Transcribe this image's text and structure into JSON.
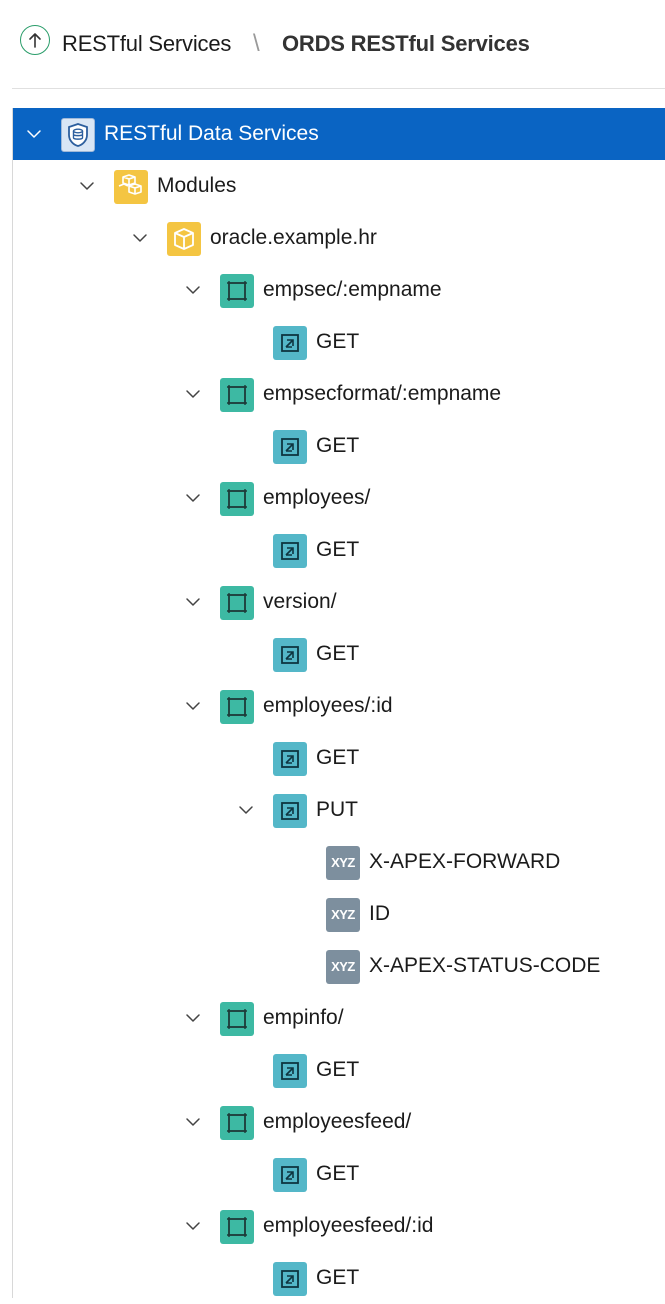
{
  "breadcrumb": {
    "parent": "RESTful Services",
    "separator": "\\",
    "current": "ORDS RESTful Services"
  },
  "tree": [
    {
      "label": "RESTful Data Services",
      "icon": "database-icon",
      "level": 0,
      "expanded": true,
      "selected": true
    },
    {
      "label": "Modules",
      "icon": "modules-icon",
      "level": 1,
      "expanded": true
    },
    {
      "label": "oracle.example.hr",
      "icon": "module-icon",
      "level": 2,
      "expanded": true
    },
    {
      "label": "empsec/:empname",
      "icon": "template-icon",
      "level": 3,
      "expanded": true
    },
    {
      "label": "GET",
      "icon": "handler-icon",
      "level": 4
    },
    {
      "label": "empsecformat/:empname",
      "icon": "template-icon",
      "level": 3,
      "expanded": true
    },
    {
      "label": "GET",
      "icon": "handler-icon",
      "level": 4
    },
    {
      "label": "employees/",
      "icon": "template-icon",
      "level": 3,
      "expanded": true
    },
    {
      "label": "GET",
      "icon": "handler-icon",
      "level": 4
    },
    {
      "label": "version/",
      "icon": "template-icon",
      "level": 3,
      "expanded": true
    },
    {
      "label": "GET",
      "icon": "handler-icon",
      "level": 4
    },
    {
      "label": "employees/:id",
      "icon": "template-icon",
      "level": 3,
      "expanded": true
    },
    {
      "label": "GET",
      "icon": "handler-icon",
      "level": 4
    },
    {
      "label": "PUT",
      "icon": "handler-icon",
      "level": 4,
      "expanded": true
    },
    {
      "label": "X-APEX-FORWARD",
      "icon": "parameter-icon",
      "icon_text": "XYZ",
      "level": 5
    },
    {
      "label": "ID",
      "icon": "parameter-icon",
      "icon_text": "XYZ",
      "level": 5
    },
    {
      "label": "X-APEX-STATUS-CODE",
      "icon": "parameter-icon",
      "icon_text": "XYZ",
      "level": 5
    },
    {
      "label": "empinfo/",
      "icon": "template-icon",
      "level": 3,
      "expanded": true
    },
    {
      "label": "GET",
      "icon": "handler-icon",
      "level": 4
    },
    {
      "label": "employeesfeed/",
      "icon": "template-icon",
      "level": 3,
      "expanded": true
    },
    {
      "label": "GET",
      "icon": "handler-icon",
      "level": 4
    },
    {
      "label": "employeesfeed/:id",
      "icon": "template-icon",
      "level": 3,
      "expanded": true
    },
    {
      "label": "GET",
      "icon": "handler-icon",
      "level": 4
    }
  ],
  "colors": {
    "selection": "#0a64c3",
    "module": "#f4c542",
    "template": "#3db9a3",
    "handler": "#54b7c8",
    "parameter": "#7d8f9e",
    "accent": "#2a9d6a"
  }
}
